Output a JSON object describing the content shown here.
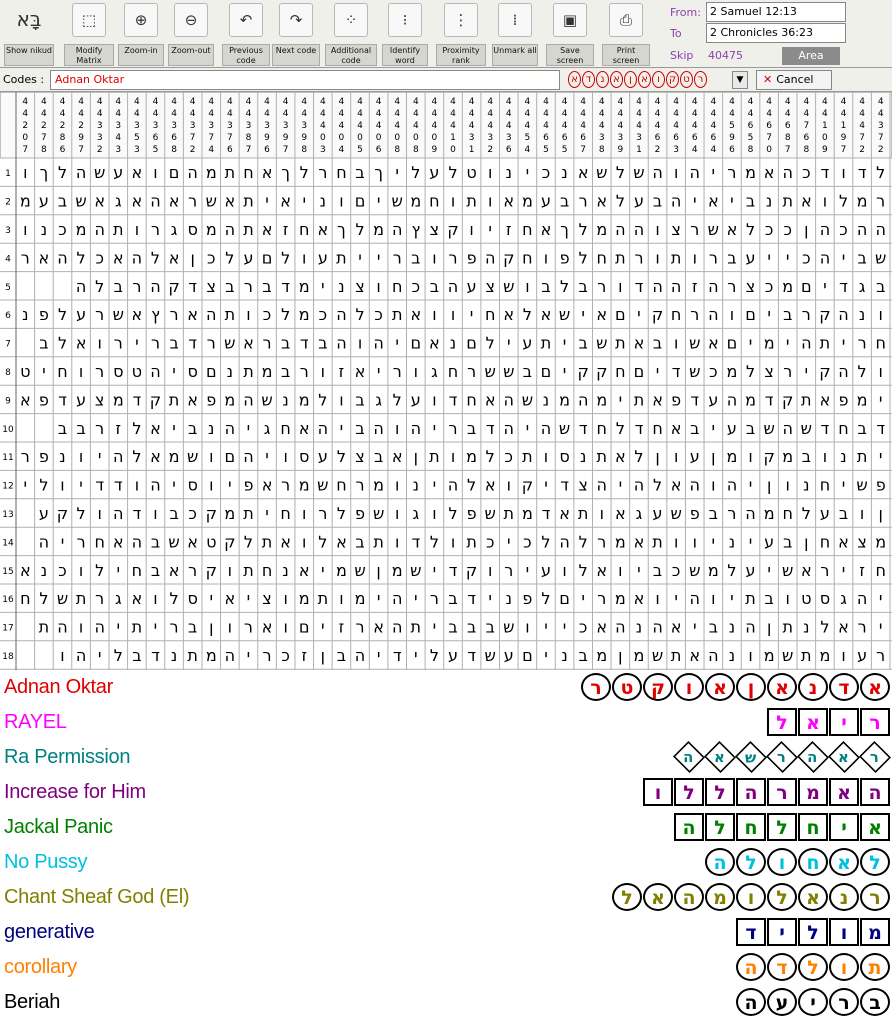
{
  "toolbar": {
    "logo_glyph": "בָּא",
    "buttons": [
      {
        "label": "Show nikud",
        "icon": "hebrew-logo-icon",
        "glyph": "בָּא"
      },
      {
        "label": "Modify Matrix",
        "icon": "modify-matrix-icon",
        "glyph": "⬚"
      },
      {
        "label": "Zoom-in",
        "icon": "zoom-in-icon",
        "glyph": "⊕"
      },
      {
        "label": "Zoom-out",
        "icon": "zoom-out-icon",
        "glyph": "⊖"
      },
      {
        "label": "Previous code",
        "icon": "previous-code-icon",
        "glyph": "↶"
      },
      {
        "label": "Next code",
        "icon": "next-code-icon",
        "glyph": "↷"
      },
      {
        "label": "Additional code",
        "icon": "additional-code-icon",
        "glyph": "⁘"
      },
      {
        "label": "Identify word",
        "icon": "identify-word-icon",
        "glyph": "⁝"
      },
      {
        "label": "Proximity rank",
        "icon": "proximity-rank-icon",
        "glyph": "⋮"
      },
      {
        "label": "Unmark all",
        "icon": "unmark-all-icon",
        "glyph": "⁞"
      },
      {
        "label": "Save screen",
        "icon": "save-screen-icon",
        "glyph": "▣"
      },
      {
        "label": "Print screen",
        "icon": "print-screen-icon",
        "glyph": "⎙"
      }
    ],
    "from_label": "From:",
    "from_value": "2 Samuel 12:13",
    "to_label": "To",
    "to_value": "2 Chronicles 36:23",
    "skip_label": "Skip",
    "skip_value": "40475",
    "area_label": "Area"
  },
  "codes": {
    "label": "Codes :",
    "value": "Adnan Oktar",
    "letters": [
      "א",
      "ד",
      "נ",
      "א",
      "ן",
      "א",
      "ו",
      "ק",
      "ט",
      "ר"
    ],
    "cancel_label": "Cancel"
  },
  "grid": {
    "col_numbers": [
      "4\n4\n3\n7\n2",
      "4\n4\n4\n7\n2",
      "4\n4\n1\n9\n7",
      "4\n4\n1\n0\n9",
      "4\n4\n7\n6\n8",
      "4\n4\n6\n8\n7",
      "4\n4\n6\n7\n0",
      "4\n4\n6\n5\n8",
      "4\n4\n5\n9\n6",
      "4\n4\n4\n6\n4",
      "4\n4\n4\n6\n4",
      "4\n4\n4\n6\n3",
      "4\n4\n4\n6\n2",
      "4\n4\n4\n3\n1",
      "4\n4\n4\n3\n9",
      "4\n4\n4\n3\n8",
      "4\n4\n4\n6\n7",
      "4\n4\n4\n6\n5",
      "4\n4\n4\n6\n5",
      "4\n4\n4\n5\n4",
      "4\n4\n4\n3\n6",
      "4\n4\n4\n3\n2",
      "4\n4\n4\n3\n1",
      "4\n4\n4\n1\n0",
      "4\n4\n4\n0\n9",
      "4\n4\n4\n0\n8",
      "4\n4\n4\n0\n8",
      "4\n4\n4\n0\n6",
      "4\n4\n4\n0\n5",
      "4\n4\n4\n0\n4",
      "4\n4\n4\n0\n3",
      "4\n4\n3\n9\n8",
      "4\n4\n3\n9\n7",
      "4\n4\n3\n9\n6",
      "4\n4\n3\n8\n7",
      "4\n4\n3\n7\n6",
      "4\n4\n3\n7\n4",
      "4\n4\n3\n7\n2",
      "4\n4\n3\n6\n8",
      "4\n4\n3\n6\n5",
      "4\n4\n3\n5\n3",
      "4\n4\n3\n4\n3",
      "4\n4\n3\n3\n2",
      "4\n4\n2\n9\n7",
      "4\n4\n2\n8\n6",
      "4\n4\n2\n7\n8",
      "4\n4\n2\n0\n7"
    ],
    "row_numbers": [
      "1",
      "2",
      "3",
      "4",
      "5",
      "6",
      "7",
      "8",
      "9",
      "10",
      "11",
      "12",
      "13",
      "14",
      "15",
      "16",
      "17",
      "18"
    ],
    "rows": [
      "לדודכהאמריהוהשלשאנכינוטלעליךבחרלךאחתמהםואעשהלךו",
      "רמלואתנביאיהבעלארבעמאותוחמשיםוניאיתאשראהאגאשבעמאו",
      "ההכהןככלאשרצוההמלךאחזיוקצץהמלךאחזאתהמסגרותהמכנו",
      "שביהכייעברותורתחלפוחקהפרוברייתעולםעלכןאלהאכלהארץו",
      "בגדיםמכצרהזההדורבלבושצעהבכחוצנימדברבצדקהרבלה",
      "ונהקרביםוהרחקיםאישאלאחיוואתכלהכמלכותהארץאשרעלפנ",
      "חריתהימיםאשובאתשביתעילםנאםיהוהבדבראשרדברירואלב",
      "ולהקירצלמכשדיםחקקיםבששרחגוריאזורבמתנםסיהטסרוחיט",
      "ימפאתקדמהעדפאתימהמנשהאחדועלגבולמנשהמפאתקדמצעדפא",
      "דבחדשהשבעיבאחדלחדשהיהדבריהוהביהאחגיהנביאלזרבב",
      "יתנובמקומןעוןלאתנסותכלמותןאבצלעסויהםושמאלהיונפר",
      "פשיחנוןיהוהאלהיהצדיקואלהינומרחשמראפיוסיהודדיוליו",
      "ןובעלחמהרבפשעגאותאדמתשפלוגושפלרוחיתמקכבודהולקע",
      "מצאחןבעיניוותאמרלהלכיכתולדותבאלואתלקטאשבהאחריה",
      "חזיראשיעלמשכביואלועירוקדישמןשמיאנחתוקראבחילוכנא",
      "יהגסטובתיוהיואמריםלפנידבריהימותמוציאיסלואגרתשלח",
      "יראלנתןהנביאהנהאכייושבבביתהארזיםוארוןבריתיהוהת",
      "רעומתשמונהאתשמןמבניםעשדעלידיהבןזכריהמתנדבליהו"
    ]
  },
  "legend": [
    {
      "name": "Adnan Oktar",
      "color": "#e00000",
      "style": "oval",
      "letters": [
        "א",
        "ד",
        "נ",
        "א",
        "ן",
        "א",
        "ו",
        "ק",
        "ט",
        "ר"
      ]
    },
    {
      "name": "RAYEL",
      "color": "#ff00ff",
      "style": "box",
      "letters": [
        "ר",
        "י",
        "א",
        "ל"
      ]
    },
    {
      "name": "Ra Permission",
      "color": "#008080",
      "style": "dia",
      "letters": [
        "ר",
        "א",
        "ה",
        "ר",
        "ש",
        "א",
        "ה"
      ]
    },
    {
      "name": "Increase for Him",
      "color": "#800080",
      "style": "box",
      "letters": [
        "ה",
        "א",
        "מ",
        "ר",
        "ה",
        "ל",
        "ל",
        "ו"
      ]
    },
    {
      "name": "Jackal Panic",
      "color": "#008000",
      "style": "box",
      "letters": [
        "א",
        "י",
        "ח",
        "ל",
        "ח",
        "ל",
        "ה"
      ]
    },
    {
      "name": "No Pussy",
      "color": "#00c0e0",
      "style": "oval",
      "letters": [
        "ל",
        "א",
        "ח",
        "ו",
        "ל",
        "ה"
      ]
    },
    {
      "name": "Chant Sheaf God (El)",
      "color": "#808000",
      "style": "oval",
      "letters": [
        "ר",
        "נ",
        "א",
        "ל",
        "ו",
        "מ",
        "ה",
        "א",
        "ל"
      ]
    },
    {
      "name": "generative",
      "color": "#000080",
      "style": "box",
      "letters": [
        "מ",
        "ו",
        "ל",
        "י",
        "ד"
      ]
    },
    {
      "name": "corollary",
      "color": "#ff8000",
      "style": "oval",
      "letters": [
        "ת",
        "ו",
        "ל",
        "ד",
        "ה"
      ]
    },
    {
      "name": "Beriah",
      "color": "#000000",
      "style": "oval",
      "letters": [
        "ב",
        "ר",
        "י",
        "ע",
        "ה"
      ]
    }
  ]
}
